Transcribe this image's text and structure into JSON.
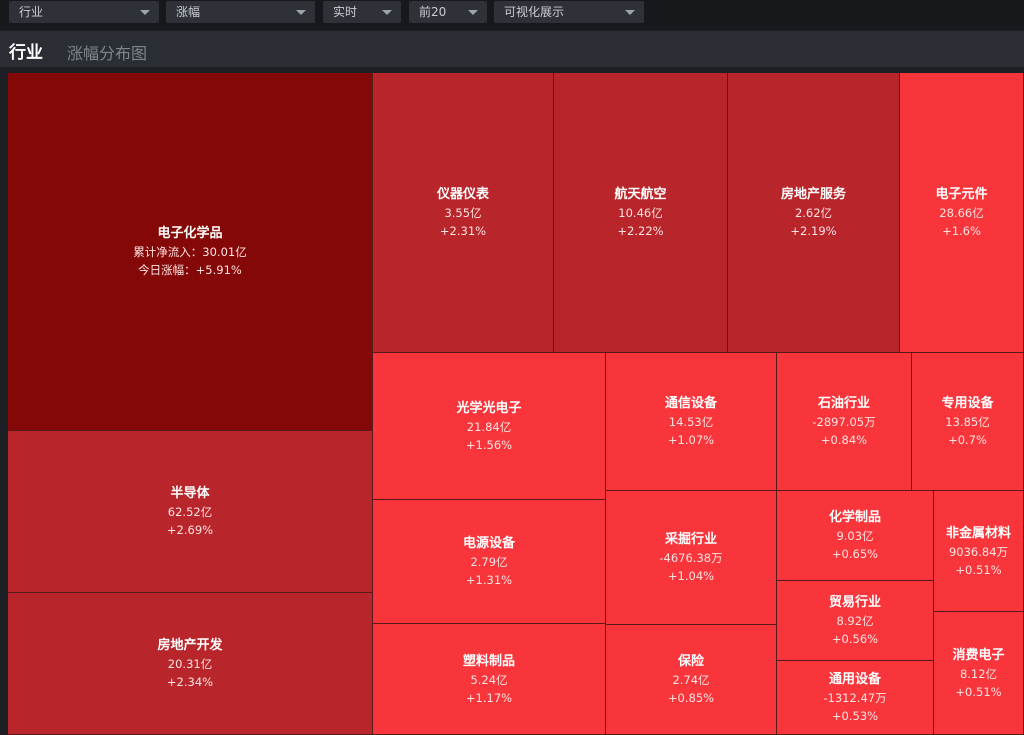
{
  "filters": {
    "category": "行业",
    "metric": "涨幅",
    "period": "实时",
    "top": "前20",
    "view": "可视化展示"
  },
  "header": {
    "title": "行业",
    "subtitle": "涨幅分布图"
  },
  "colors": {
    "dark": "#850808",
    "mid": "#b8252b",
    "light": "#f7353b"
  },
  "chart_data": {
    "type": "treemap",
    "items": [
      {
        "name": "电子化学品",
        "net_inflow": "累计净流入：30.01亿",
        "change": "今日涨幅：+5.91%",
        "change_pct": 5.91
      },
      {
        "name": "半导体",
        "net_inflow": "62.52亿",
        "change": "+2.69%",
        "change_pct": 2.69
      },
      {
        "name": "房地产开发",
        "net_inflow": "20.31亿",
        "change": "+2.34%",
        "change_pct": 2.34
      },
      {
        "name": "仪器仪表",
        "net_inflow": "3.55亿",
        "change": "+2.31%",
        "change_pct": 2.31
      },
      {
        "name": "航天航空",
        "net_inflow": "10.46亿",
        "change": "+2.22%",
        "change_pct": 2.22
      },
      {
        "name": "房地产服务",
        "net_inflow": "2.62亿",
        "change": "+2.19%",
        "change_pct": 2.19
      },
      {
        "name": "电子元件",
        "net_inflow": "28.66亿",
        "change": "+1.6%",
        "change_pct": 1.6
      },
      {
        "name": "光学光电子",
        "net_inflow": "21.84亿",
        "change": "+1.56%",
        "change_pct": 1.56
      },
      {
        "name": "电源设备",
        "net_inflow": "2.79亿",
        "change": "+1.31%",
        "change_pct": 1.31
      },
      {
        "name": "塑料制品",
        "net_inflow": "5.24亿",
        "change": "+1.17%",
        "change_pct": 1.17
      },
      {
        "name": "通信设备",
        "net_inflow": "14.53亿",
        "change": "+1.07%",
        "change_pct": 1.07
      },
      {
        "name": "采掘行业",
        "net_inflow": "-4676.38万",
        "change": "+1.04%",
        "change_pct": 1.04
      },
      {
        "name": "保险",
        "net_inflow": "2.74亿",
        "change": "+0.85%",
        "change_pct": 0.85
      },
      {
        "name": "石油行业",
        "net_inflow": "-2897.05万",
        "change": "+0.84%",
        "change_pct": 0.84
      },
      {
        "name": "专用设备",
        "net_inflow": "13.85亿",
        "change": "+0.7%",
        "change_pct": 0.7
      },
      {
        "name": "化学制品",
        "net_inflow": "9.03亿",
        "change": "+0.65%",
        "change_pct": 0.65
      },
      {
        "name": "贸易行业",
        "net_inflow": "8.92亿",
        "change": "+0.56%",
        "change_pct": 0.56
      },
      {
        "name": "通用设备",
        "net_inflow": "-1312.47万",
        "change": "+0.53%",
        "change_pct": 0.53
      },
      {
        "name": "非金属材料",
        "net_inflow": "9036.84万",
        "change": "+0.51%",
        "change_pct": 0.51
      },
      {
        "name": "消费电子",
        "net_inflow": "8.12亿",
        "change": "+0.51%",
        "change_pct": 0.51
      }
    ]
  }
}
